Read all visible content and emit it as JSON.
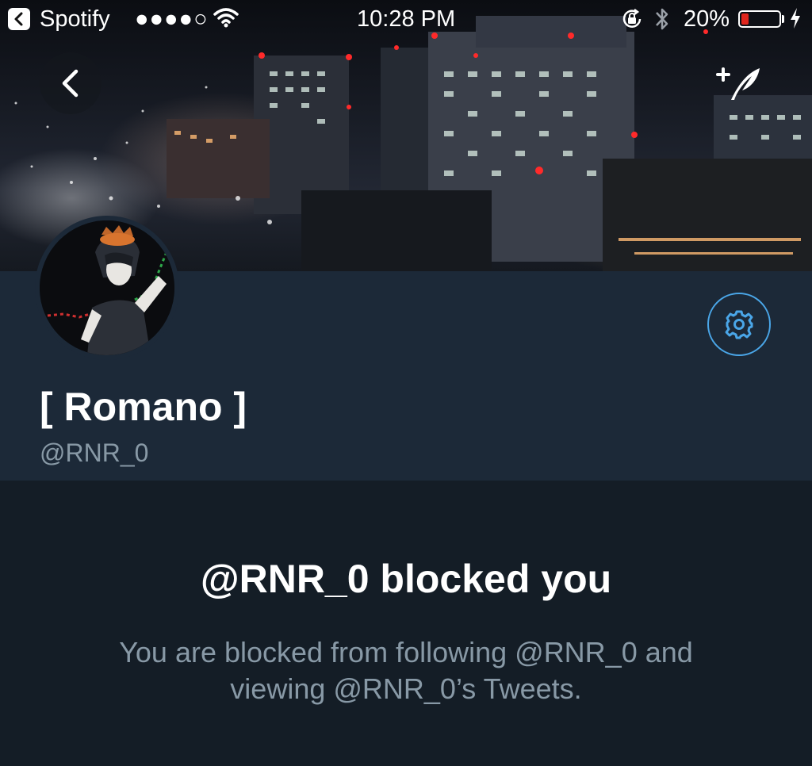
{
  "status_bar": {
    "back_app": "Spotify",
    "signal": "●●●●○",
    "time": "10:28 PM",
    "battery_percent": "20%",
    "battery_level": 0.2,
    "icons": [
      "back-chevron-icon",
      "wifi-icon",
      "orientation-lock-icon",
      "bluetooth-icon",
      "battery-icon",
      "charging-bolt-icon"
    ]
  },
  "nav": {
    "back_icon": "chevron-left-icon",
    "compose_icon": "compose-tweet-icon"
  },
  "profile": {
    "display_name": "[ Romano ]",
    "handle": "@RNR_0",
    "settings_icon": "gear-icon"
  },
  "blocked": {
    "title": "@RNR_0 blocked you",
    "description": "You are blocked from following @RNR_0 and viewing @RNR_0’s Tweets."
  },
  "colors": {
    "background": "#141d26",
    "profile_band": "#1c2938",
    "accent": "#4aa6e8",
    "secondary_text": "#8899a6",
    "battery_low": "#e0251c"
  }
}
